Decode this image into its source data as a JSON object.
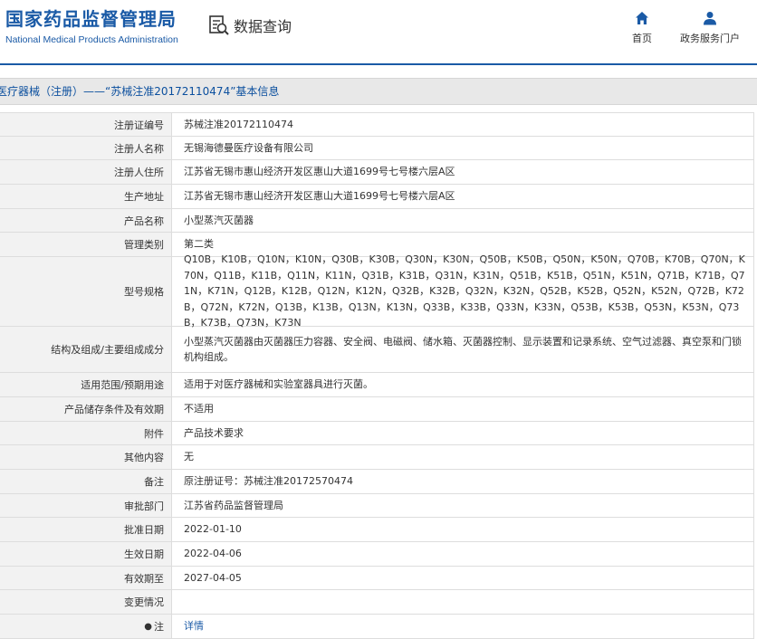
{
  "header": {
    "brand_cn": "国家药品监督管理局",
    "brand_en": "National Medical Products Administration",
    "query_label": "数据查询",
    "nav": {
      "home": "首页",
      "portal": "政务服务门户"
    },
    "accent_color": "#1a5aa6"
  },
  "title": "医疗器械（注册）——“苏械注准20172110474”基本信息",
  "rows": [
    {
      "label": "注册证编号",
      "value": "苏械注准20172110474"
    },
    {
      "label": "注册人名称",
      "value": "无锡海德曼医疗设备有限公司"
    },
    {
      "label": "注册人住所",
      "value": "江苏省无锡市惠山经济开发区惠山大道1699号七号楼六层A区"
    },
    {
      "label": "生产地址",
      "value": "江苏省无锡市惠山经济开发区惠山大道1699号七号楼六层A区"
    },
    {
      "label": "产品名称",
      "value": "小型蒸汽灭菌器"
    },
    {
      "label": "管理类别",
      "value": "第二类"
    },
    {
      "label": "型号规格",
      "value": "Q10B，K10B，Q10N，K10N，Q30B，K30B，Q30N，K30N，Q50B，K50B，Q50N，K50N，Q70B，K70B，Q70N，K70N，Q11B，K11B，Q11N，K11N，Q31B，K31B，Q31N，K31N，Q51B，K51B，Q51N，K51N，Q71B，K71B，Q71N，K71N，Q12B，K12B，Q12N，K12N，Q32B，K32B，Q32N，K32N，Q52B，K52B，Q52N，K52N，Q72B，K72B，Q72N，K72N，Q13B，K13B，Q13N，K13N，Q33B，K33B，Q33N，K33N，Q53B，K53B，Q53N，K53N，Q73B，K73B，Q73N，K73N"
    },
    {
      "label": "结构及组成/主要组成成分",
      "value": "小型蒸汽灭菌器由灭菌器压力容器、安全阀、电磁阀、储水箱、灭菌器控制、显示装置和记录系统、空气过滤器、真空泵和门锁机构组成。"
    },
    {
      "label": "适用范围/预期用途",
      "value": "适用于对医疗器械和实验室器具进行灭菌。"
    },
    {
      "label": "产品储存条件及有效期",
      "value": "不适用"
    },
    {
      "label": "附件",
      "value": "产品技术要求"
    },
    {
      "label": "其他内容",
      "value": "无"
    },
    {
      "label": "备注",
      "value": "原注册证号：苏械注准20172570474"
    },
    {
      "label": "审批部门",
      "value": "江苏省药品监督管理局"
    },
    {
      "label": "批准日期",
      "value": "2022-01-10"
    },
    {
      "label": "生效日期",
      "value": "2022-04-06"
    },
    {
      "label": "有效期至",
      "value": "2027-04-05"
    },
    {
      "label": "变更情况",
      "value": ""
    },
    {
      "label": "注",
      "value": "详情"
    }
  ]
}
